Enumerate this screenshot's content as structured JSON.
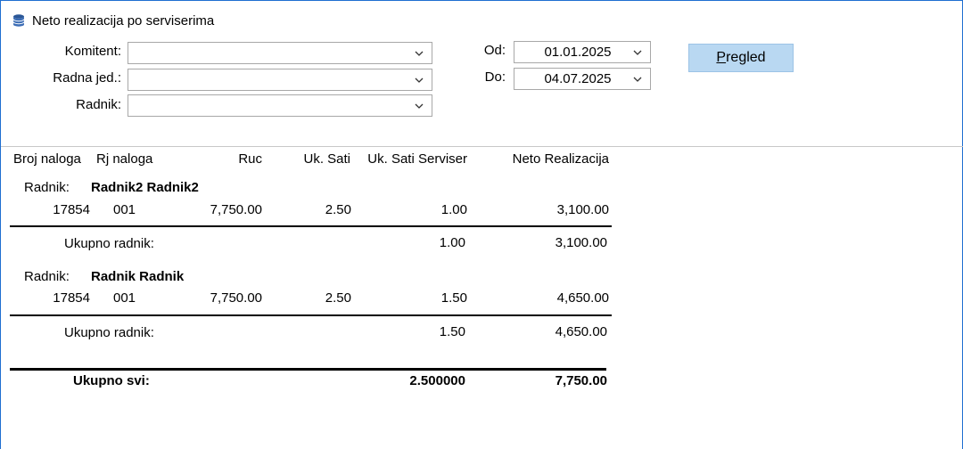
{
  "window": {
    "title": "Neto realizacija po serviserima",
    "icon": "database-icon"
  },
  "filters": {
    "komitent": {
      "label": "Komitent:",
      "value": ""
    },
    "radna_jed": {
      "label": "Radna jed.:",
      "value": ""
    },
    "radnik": {
      "label": "Radnik:",
      "value": ""
    },
    "od": {
      "label": "Od:",
      "value": "01.01.2025"
    },
    "do": {
      "label": "Do:",
      "value": "04.07.2025"
    }
  },
  "button": {
    "pregled_first": "P",
    "pregled_rest": "regled"
  },
  "report": {
    "headers": [
      "Broj naloga",
      "Rj naloga",
      "Ruc",
      "Uk. Sati",
      "Uk. Sati Serviser",
      "Neto Realizacija"
    ],
    "groups": [
      {
        "label": "Radnik:",
        "name": "Radnik2 Radnik2",
        "row": {
          "broj": "17854",
          "rj": "001",
          "ruc": "7,750.00",
          "uk_sati": "2.50",
          "uk_sati_serviser": "1.00",
          "neto": "3,100.00"
        },
        "total_label": "Ukupno radnik:",
        "total_sati_serviser": "1.00",
        "total_neto": "3,100.00"
      },
      {
        "label": "Radnik:",
        "name": "Radnik Radnik",
        "row": {
          "broj": "17854",
          "rj": "001",
          "ruc": "7,750.00",
          "uk_sati": "2.50",
          "uk_sati_serviser": "1.50",
          "neto": "4,650.00"
        },
        "total_label": "Ukupno radnik:",
        "total_sati_serviser": "1.50",
        "total_neto": "4,650.00"
      }
    ],
    "grand_total": {
      "label": "Ukupno svi:",
      "sati_serviser": "2.500000",
      "neto": "7,750.00"
    }
  }
}
